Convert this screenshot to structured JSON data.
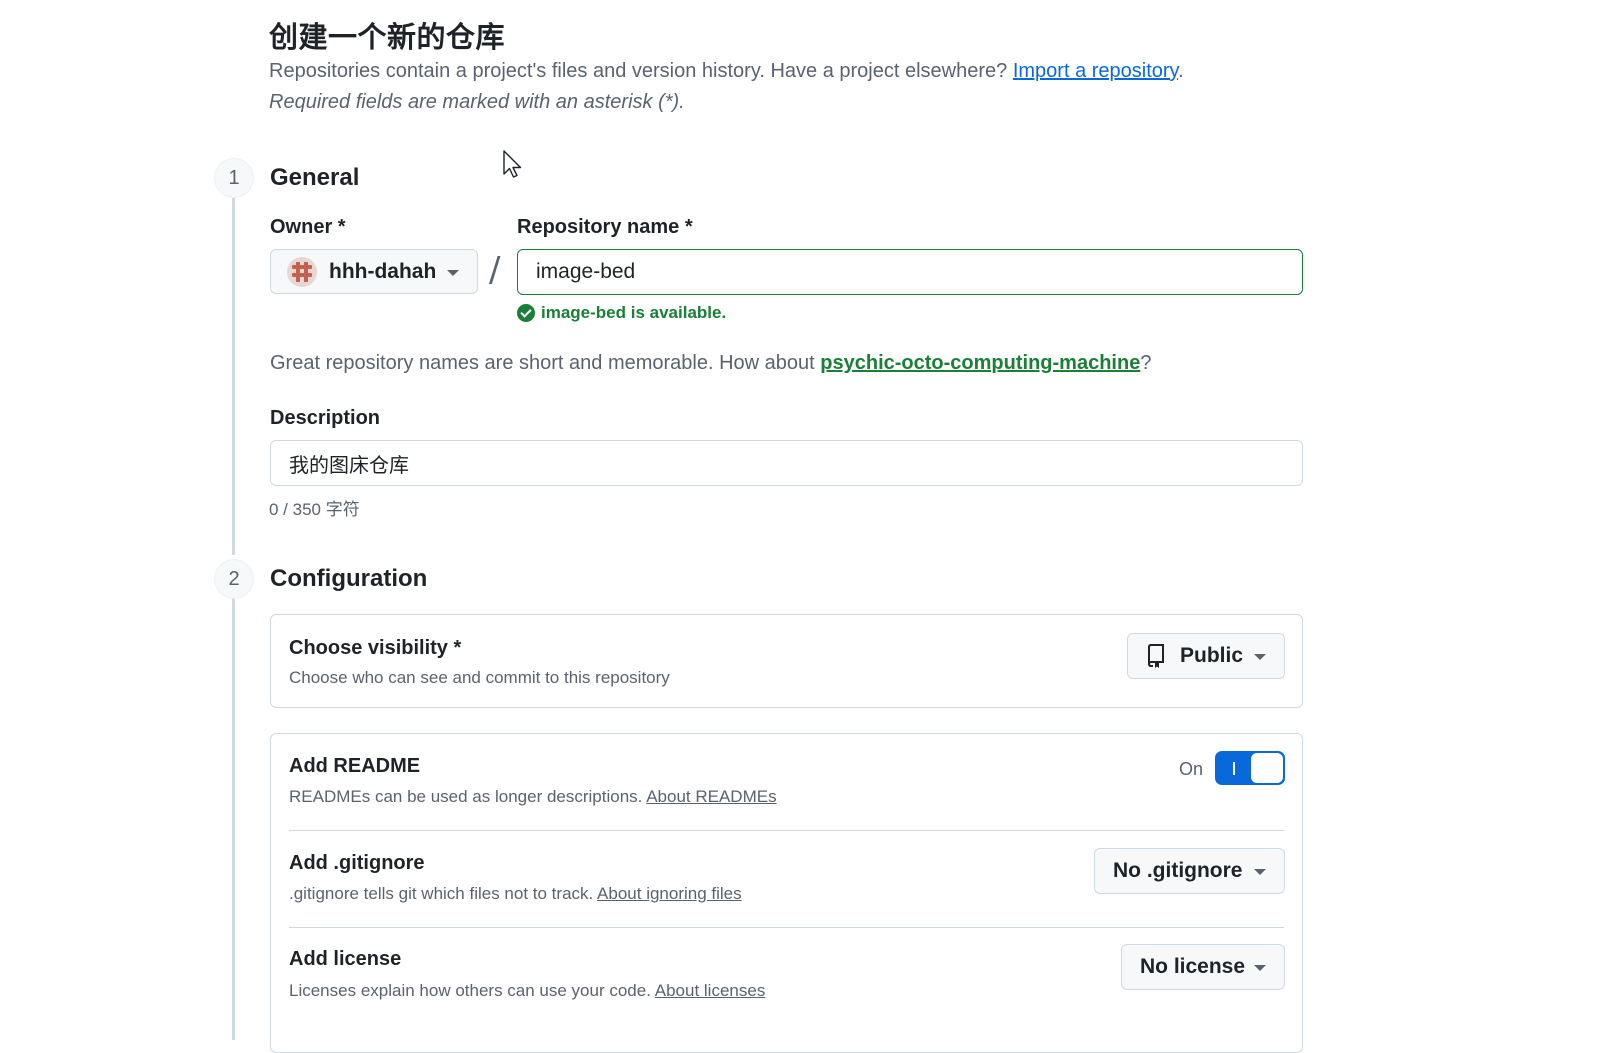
{
  "page": {
    "title": "创建一个新的仓库",
    "intro_text": "Repositories contain a project's files and version history. Have a project elsewhere?",
    "import_link": "Import a repository",
    "intro_end": ".",
    "required_note": "Required fields are marked with an asterisk (*)."
  },
  "general": {
    "step_number": "1",
    "title": "General",
    "owner_label": "Owner *",
    "owner_value": "hhh-dahah",
    "separator": "/",
    "repo_name_label": "Repository name *",
    "repo_name_value": "image-bed",
    "availability": "image-bed is available.",
    "suggestion_text": "Great repository names are short and memorable. How about",
    "suggestion_link": "psychic-octo-computing-machine",
    "suggestion_end": "?",
    "description_label": "Description",
    "description_value": "我的图床仓库",
    "char_count": "0 / 350 字符"
  },
  "configuration": {
    "step_number": "2",
    "title": "Configuration",
    "visibility": {
      "title": "Choose visibility *",
      "subtitle": "Choose who can see and commit to this repository",
      "value": "Public"
    },
    "readme": {
      "title": "Add README",
      "subtitle": "READMEs can be used as longer descriptions.",
      "link": "About READMEs",
      "toggle_label": "On",
      "enabled": true
    },
    "gitignore": {
      "title": "Add .gitignore",
      "subtitle": ".gitignore tells git which files not to track.",
      "link": "About ignoring files",
      "value": "No .gitignore"
    },
    "license": {
      "title": "Add license",
      "subtitle": "Licenses explain how others can use your code.",
      "link": "About licenses",
      "value": "No license"
    }
  },
  "colors": {
    "accent_blue": "#0969da",
    "success_green": "#1a7f37",
    "muted_text": "#59636e",
    "border": "#d1d9e0"
  },
  "icons": [
    "avatar-identicon",
    "caret-down-icon",
    "check-circle-icon",
    "repo-icon",
    "mouse-cursor-icon"
  ]
}
